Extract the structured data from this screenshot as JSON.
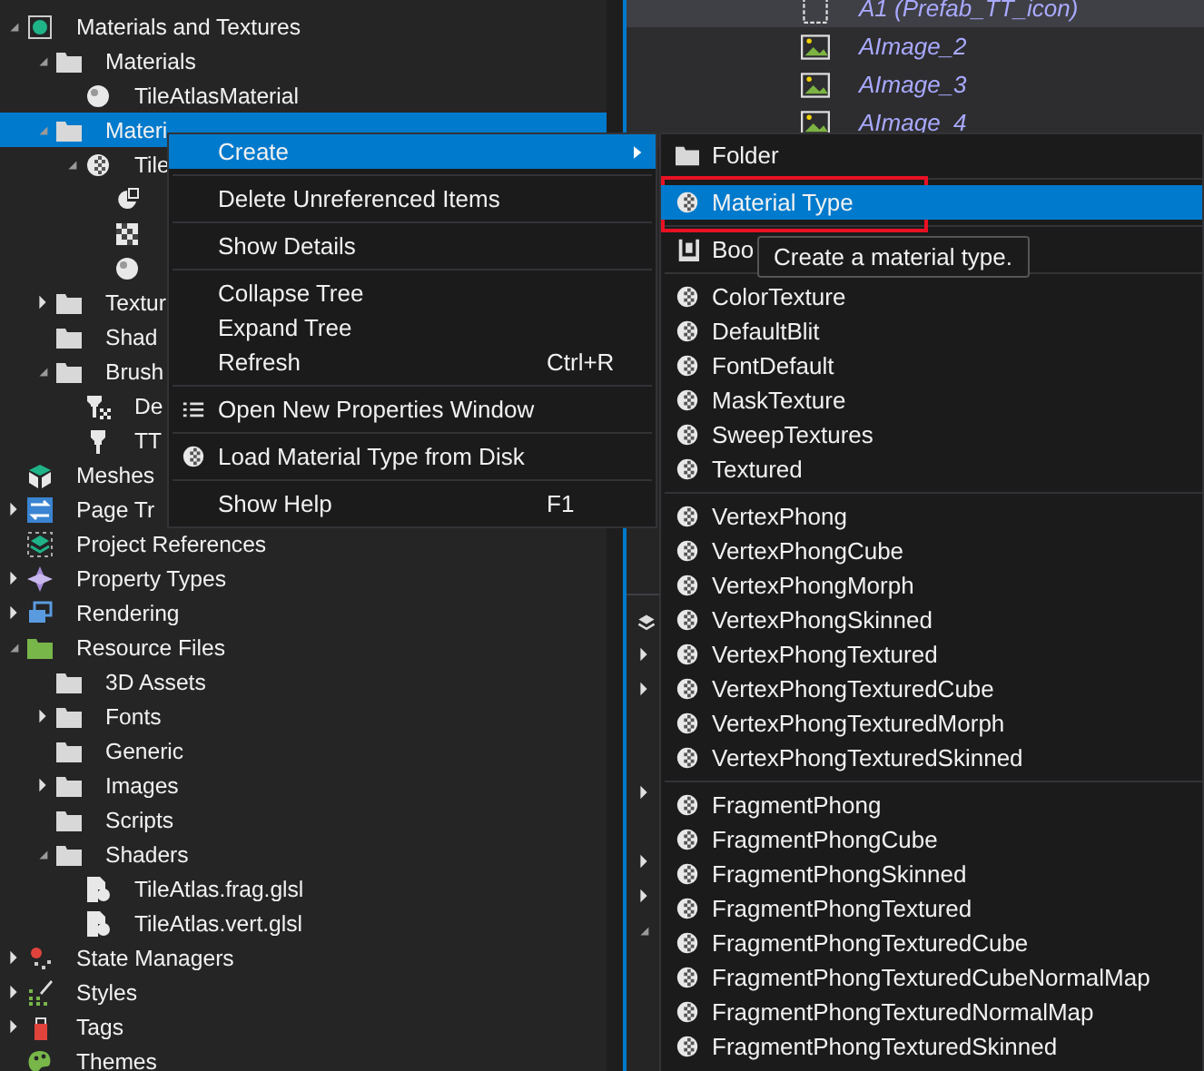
{
  "tree": [
    {
      "label": "Materials and Textures",
      "kind": "material-set",
      "expanded": true,
      "selected": false,
      "children": [
        {
          "label": "Materials",
          "kind": "folder",
          "expanded": true,
          "selected": false,
          "children": [
            {
              "label": "TileAtlasMaterial",
              "kind": "sphere",
              "selected": false
            }
          ]
        },
        {
          "label": "Materi",
          "kind": "folder",
          "expanded": true,
          "selected": true,
          "children": [
            {
              "label": "Tile",
              "kind": "checker-sphere",
              "expanded": true,
              "selected": false,
              "children": [
                {
                  "kind": "pie",
                  "selected": false
                },
                {
                  "kind": "checker",
                  "selected": false
                },
                {
                  "kind": "sphere",
                  "selected": false
                }
              ]
            }
          ]
        },
        {
          "label": "Textur",
          "kind": "folder",
          "expanded": false,
          "selected": false
        },
        {
          "label": "Shad",
          "kind": "folder",
          "selected": false
        },
        {
          "label": "Brush",
          "kind": "folder",
          "expanded": true,
          "selected": false,
          "children": [
            {
              "label": "De",
              "kind": "brush-checker",
              "selected": false
            },
            {
              "label": "TT",
              "kind": "brush",
              "selected": false
            }
          ]
        }
      ]
    },
    {
      "label": "Meshes",
      "kind": "cube",
      "selected": false
    },
    {
      "label": "Page Tr",
      "kind": "swap",
      "expanded": false,
      "selected": false
    },
    {
      "label": "Project References",
      "kind": "layers",
      "selected": false
    },
    {
      "label": "Property Types",
      "kind": "diamond",
      "expanded": false,
      "selected": false
    },
    {
      "label": "Rendering",
      "kind": "windows",
      "expanded": false,
      "selected": false
    },
    {
      "label": "Resource Files",
      "kind": "folder-green",
      "expanded": true,
      "selected": false,
      "children": [
        {
          "label": "3D Assets",
          "kind": "folder",
          "selected": false
        },
        {
          "label": "Fonts",
          "kind": "folder",
          "expanded": false,
          "selected": false
        },
        {
          "label": "Generic",
          "kind": "folder",
          "selected": false
        },
        {
          "label": "Images",
          "kind": "folder",
          "expanded": false,
          "selected": false
        },
        {
          "label": "Scripts",
          "kind": "folder",
          "selected": false
        },
        {
          "label": "Shaders",
          "kind": "folder",
          "expanded": true,
          "selected": false,
          "children": [
            {
              "label": "TileAtlas.frag.glsl",
              "kind": "script-file",
              "selected": false
            },
            {
              "label": "TileAtlas.vert.glsl",
              "kind": "script-file",
              "selected": false
            }
          ]
        }
      ]
    },
    {
      "label": "State Managers",
      "kind": "state",
      "expanded": false,
      "selected": false
    },
    {
      "label": "Styles",
      "kind": "styles",
      "expanded": false,
      "selected": false
    },
    {
      "label": "Tags",
      "kind": "tag",
      "expanded": false,
      "selected": false
    },
    {
      "label": "Themes",
      "kind": "palette",
      "selected": false
    }
  ],
  "asset_list": [
    {
      "label": "A1 (Prefab_TT_icon)",
      "kind": "dashed",
      "selected": true
    },
    {
      "label": "AImage_2",
      "kind": "image",
      "selected": false
    },
    {
      "label": "AImage_3",
      "kind": "image",
      "selected": false
    },
    {
      "label": "AImage_4",
      "kind": "image",
      "selected": false
    }
  ],
  "lower_panel": {
    "rows": [
      {
        "kind": "expander",
        "expanded": false
      },
      {
        "kind": "expander",
        "expanded": false
      },
      {
        "kind": "leaf"
      },
      {
        "kind": "leaf"
      },
      {
        "kind": "expander",
        "expanded": false
      },
      {
        "kind": "leaf"
      },
      {
        "kind": "expander",
        "expanded": false
      },
      {
        "kind": "expander",
        "expanded": false
      },
      {
        "kind": "expander",
        "expanded": true
      }
    ]
  },
  "context_menu": {
    "groups": [
      [
        {
          "label": "Create",
          "submenu": true,
          "selected": true
        }
      ],
      [
        {
          "label": "Delete Unreferenced Items",
          "selected": false
        }
      ],
      [
        {
          "label": "Show Details",
          "selected": false
        }
      ],
      [
        {
          "label": "Collapse Tree",
          "selected": false
        },
        {
          "label": "Expand Tree",
          "selected": false
        },
        {
          "label": "Refresh",
          "shortcut": "Ctrl+R",
          "selected": false
        }
      ],
      [
        {
          "label": "Open New Properties Window",
          "kind": "list",
          "selected": false
        }
      ],
      [
        {
          "label": "Load Material Type from Disk",
          "kind": "checker-sphere",
          "selected": false
        }
      ],
      [
        {
          "label": "Show Help",
          "shortcut": "F1",
          "selected": false
        }
      ]
    ]
  },
  "submenu": {
    "groups": [
      [
        {
          "label": "Folder",
          "kind": "folder",
          "selected": false
        }
      ],
      [
        {
          "label": "Material Type",
          "kind": "checker-sphere",
          "selected": true,
          "outlined": true
        }
      ],
      [
        {
          "label": "Boo",
          "kind": "book",
          "selected": false
        }
      ],
      [
        {
          "label": "ColorTexture",
          "kind": "checker-sphere",
          "selected": false
        },
        {
          "label": "DefaultBlit",
          "kind": "checker-sphere",
          "selected": false
        },
        {
          "label": "FontDefault",
          "kind": "checker-sphere",
          "selected": false
        },
        {
          "label": "MaskTexture",
          "kind": "checker-sphere",
          "selected": false
        },
        {
          "label": "SweepTextures",
          "kind": "checker-sphere",
          "selected": false
        },
        {
          "label": "Textured",
          "kind": "checker-sphere",
          "selected": false
        }
      ],
      [
        {
          "label": "VertexPhong",
          "kind": "checker-sphere",
          "selected": false
        },
        {
          "label": "VertexPhongCube",
          "kind": "checker-sphere",
          "selected": false
        },
        {
          "label": "VertexPhongMorph",
          "kind": "checker-sphere",
          "selected": false
        },
        {
          "label": "VertexPhongSkinned",
          "kind": "checker-sphere",
          "selected": false
        },
        {
          "label": "VertexPhongTextured",
          "kind": "checker-sphere",
          "selected": false
        },
        {
          "label": "VertexPhongTexturedCube",
          "kind": "checker-sphere",
          "selected": false
        },
        {
          "label": "VertexPhongTexturedMorph",
          "kind": "checker-sphere",
          "selected": false
        },
        {
          "label": "VertexPhongTexturedSkinned",
          "kind": "checker-sphere",
          "selected": false
        }
      ],
      [
        {
          "label": "FragmentPhong",
          "kind": "checker-sphere",
          "selected": false
        },
        {
          "label": "FragmentPhongCube",
          "kind": "checker-sphere",
          "selected": false
        },
        {
          "label": "FragmentPhongSkinned",
          "kind": "checker-sphere",
          "selected": false
        },
        {
          "label": "FragmentPhongTextured",
          "kind": "checker-sphere",
          "selected": false
        },
        {
          "label": "FragmentPhongTexturedCube",
          "kind": "checker-sphere",
          "selected": false
        },
        {
          "label": "FragmentPhongTexturedCubeNormalMap",
          "kind": "checker-sphere",
          "selected": false
        },
        {
          "label": "FragmentPhongTexturedNormalMap",
          "kind": "checker-sphere",
          "selected": false
        },
        {
          "label": "FragmentPhongTexturedSkinned",
          "kind": "checker-sphere",
          "selected": false
        }
      ]
    ]
  },
  "tooltip": "Create a material type."
}
